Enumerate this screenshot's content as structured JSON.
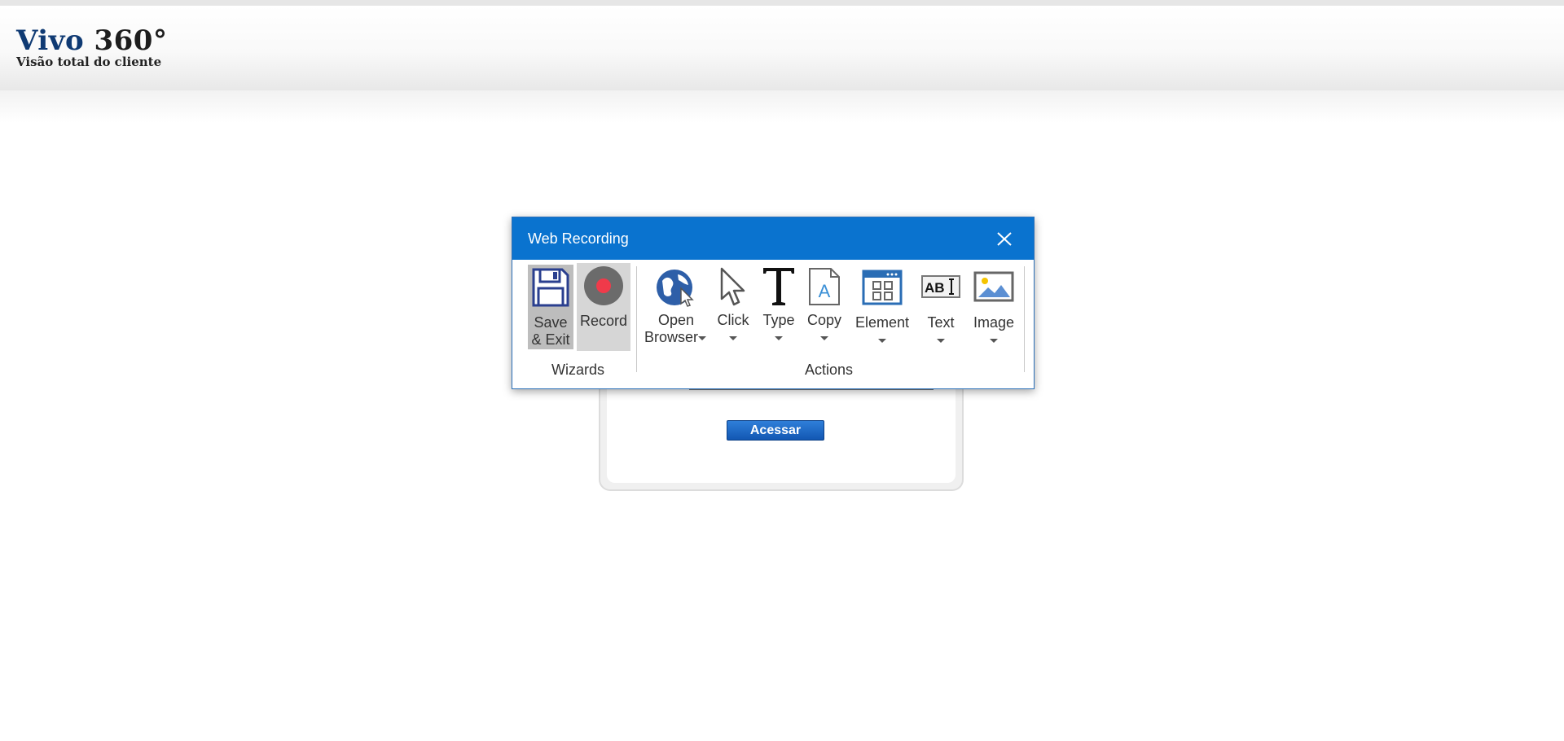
{
  "app": {
    "logo_brand": "Vivo",
    "logo_number": "360°",
    "logo_subtitle": "Visão total do cliente"
  },
  "login": {
    "submit_label": "Acessar"
  },
  "dialog": {
    "title": "Web Recording",
    "wizards": {
      "group_label": "Wizards",
      "save_exit_line1": "Save",
      "save_exit_line2": "& Exit",
      "record_label": "Record"
    },
    "actions": {
      "group_label": "Actions",
      "open_browser_line1": "Open",
      "open_browser_line2": "Browser",
      "click_label": "Click",
      "type_label": "Type",
      "copy_label": "Copy",
      "element_label": "Element",
      "text_label": "Text",
      "image_label": "Image"
    }
  },
  "colors": {
    "titlebar": "#0a73cf",
    "logo_brand": "#0f3a73",
    "record_dot": "#f03a4a",
    "button_blue": "#1257b3"
  }
}
